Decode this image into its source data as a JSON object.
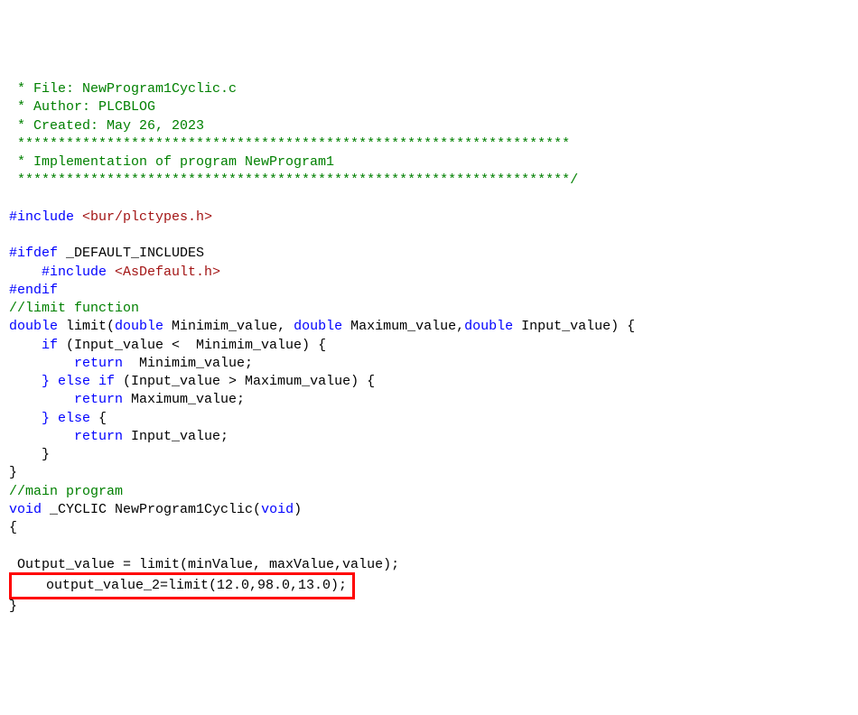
{
  "code": {
    "l1": " * File: NewProgram1Cyclic.c",
    "l2": " * Author: PLCBLOG",
    "l3": " * Created: May 26, 2023",
    "l4": " ********************************************************************",
    "l5a": " * Implementation of program NewProgram1",
    "l5b": " ********************************************************************/",
    "l6_include": "#include",
    "l6_hdr": " <bur/plctypes.h>",
    "l7_ifdef": "#ifdef",
    "l7_macro": " _DEFAULT_INCLUDES",
    "l8_include": "    #include",
    "l8_hdr": " <AsDefault.h>",
    "l9_endif": "#endif",
    "l10_comment": "//limit function",
    "l11_double1": "double",
    "l11_fn": " limit(",
    "l11_double2": "double",
    "l11_p1": " Minimim_value, ",
    "l11_double3": "double",
    "l11_p2": " Maximum_value,",
    "l11_double4": "double",
    "l11_p3": " Input_value) {",
    "l12_if": "    if",
    "l12_cond": " (Input_value <  Minimim_value) {",
    "l13_return": "        return",
    "l13_val": "  Minimim_value;",
    "l14_else": "    } else",
    "l14_if": " if",
    "l14_cond": " (Input_value > Maximum_value) {",
    "l15_return": "        return",
    "l15_val": " Maximum_value;",
    "l16_else": "    } else",
    "l16_brace": " {",
    "l17_return": "        return",
    "l17_val": " Input_value;",
    "l18": "    }",
    "l19": "}",
    "l20_comment": "//main program",
    "l21_void": "void",
    "l21_cyclic": " _CYCLIC ",
    "l21_fn": "NewProgram1Cyclic(",
    "l21_void2": "void",
    "l21_close": ")",
    "l22": "{",
    "l23": " Output_value = limit(minValue, maxValue,value);",
    "l24": "    output_value_2=limit(12.0,98.0,13.0);",
    "l25": "}"
  }
}
